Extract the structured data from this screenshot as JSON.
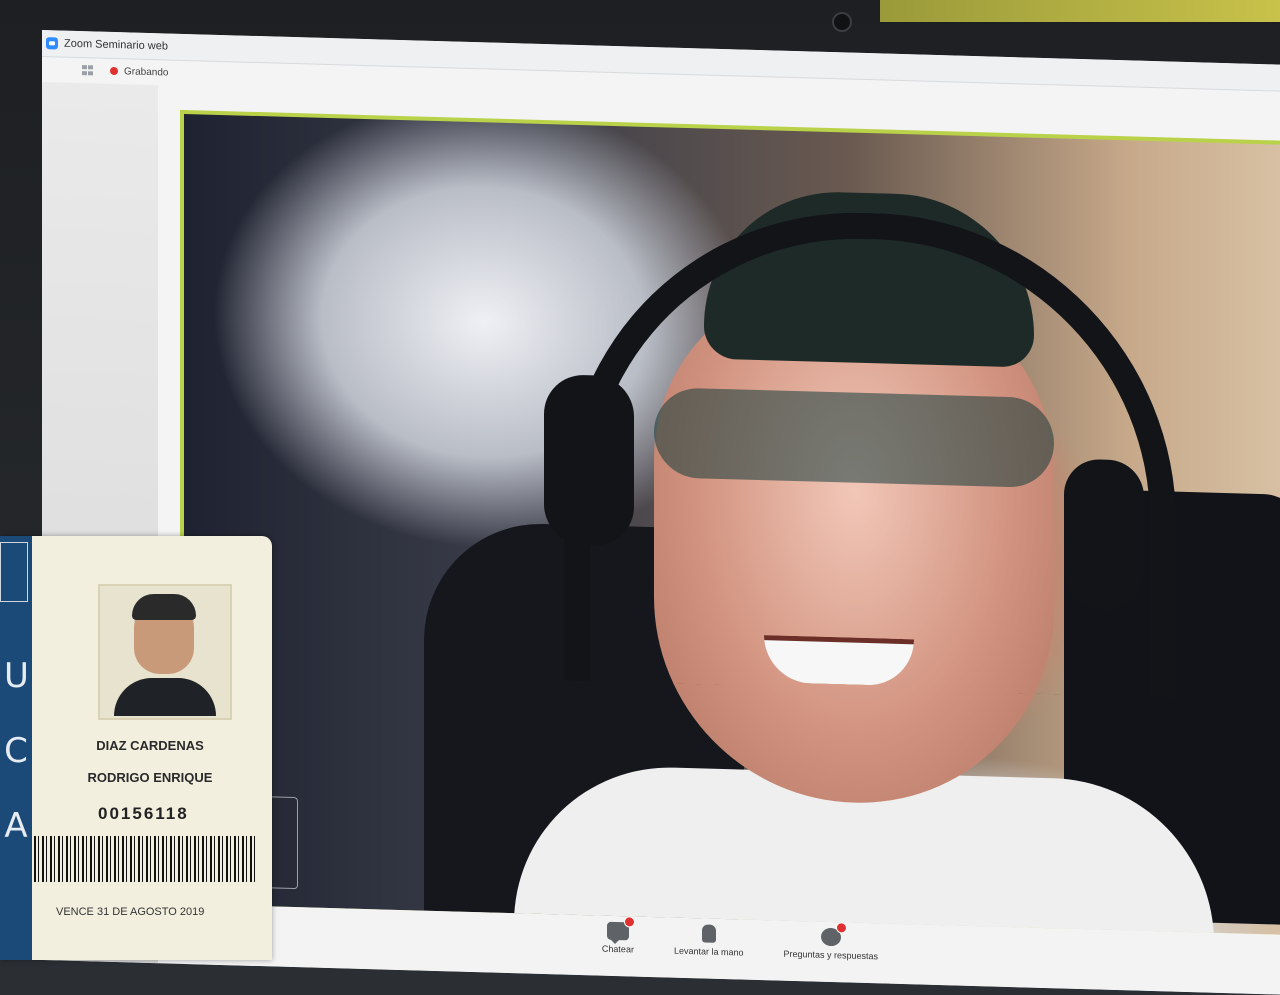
{
  "window": {
    "title": "Zoom Seminario web",
    "recording_label": "Grabando"
  },
  "toolbar": {
    "items": [
      {
        "label": "Chatear",
        "icon": "chat-icon"
      },
      {
        "label": "Levantar la mano",
        "icon": "raise-hand-icon"
      },
      {
        "label": "Preguntas y respuestas",
        "icon": "qa-icon"
      }
    ]
  },
  "id_card": {
    "stripe_letters": [
      "U",
      "C",
      "A"
    ],
    "surname": "DIAZ CARDENAS",
    "given_names": "RODRIGO ENRIQUE",
    "number": "00156118",
    "expiry": "VENCE  31 DE AGOSTO 2019"
  },
  "colors": {
    "active_speaker_border": "#b9d24a",
    "recording_dot": "#e0302f",
    "card_stripe": "#1c4a78"
  }
}
